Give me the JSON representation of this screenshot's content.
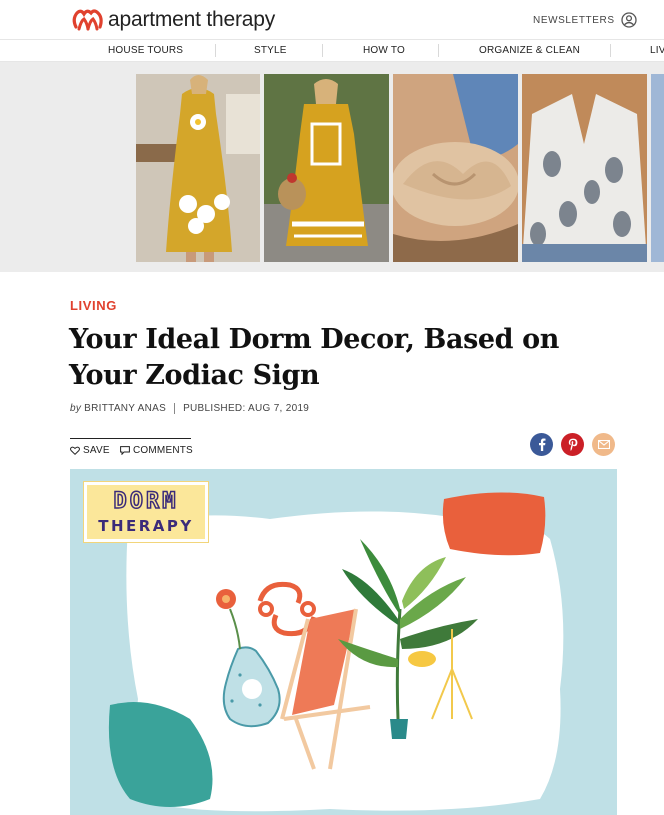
{
  "site": {
    "brand": "apartment therapy",
    "newsletters_label": "NEWSLETTERS",
    "account_icon": "user-circle-icon"
  },
  "nav": {
    "items": [
      "HOUSE TOURS",
      "STYLE",
      "HOW TO",
      "ORGANIZE & CLEAN",
      "LIV"
    ]
  },
  "ad": {
    "photos": [
      "yellow-daisy-dress-photo",
      "yellow-print-dress-photo",
      "tan-slide-sandal-photo",
      "polka-dot-blouse-photo"
    ]
  },
  "article": {
    "category": "LIVING",
    "title": "Your Ideal Dorm Decor, Based on Your Zodiac Sign",
    "byline_prefix": "by",
    "author": "BRITTANY ANAS",
    "published": "PUBLISHED: AUG 7, 2019",
    "save_label": "SAVE",
    "comments_label": "COMMENTS",
    "share": [
      {
        "name": "facebook",
        "icon": "facebook-icon",
        "color": "#3b5998"
      },
      {
        "name": "pinterest",
        "icon": "pinterest-icon",
        "color": "#cb2027"
      },
      {
        "name": "email",
        "icon": "email-icon",
        "color": "#f0b98a"
      }
    ]
  },
  "hero": {
    "badge_line1": "DORM",
    "badge_line2": "THERAPY",
    "colors": {
      "background": "#bfe0e6",
      "paper": "#ffffff",
      "coral": "#e9603c",
      "teal": "#3aa39a",
      "badge": "#fbe79a",
      "badge_text": "#3b2b7a"
    }
  },
  "colors": {
    "accent": "#e0412e"
  }
}
